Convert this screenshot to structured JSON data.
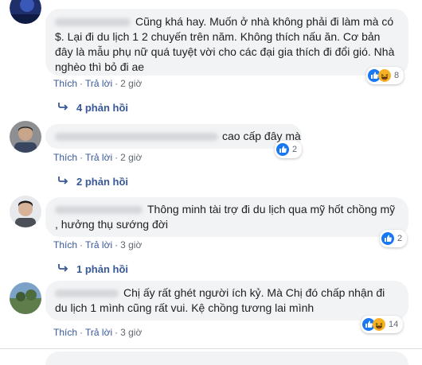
{
  "comments": [
    {
      "text_lines": [
        "Cũng khá hay. Muốn ở nhà không phải đi làm mà có",
        "$. Lại đi du lịch 1 2 chuyến trên năm. Không thích nấu ăn. Cơ bản",
        "đây là mẫu phụ nữ quá tuyệt vời cho các đại gia thích đi đổi gió. Nhà",
        "nghèo thì bỏ đi ae"
      ],
      "actions": {
        "like": "Thích",
        "reply": "Trả lời",
        "time": "2 giờ"
      },
      "reaction_count": "8",
      "replies": "4 phản hồi"
    },
    {
      "text_lines": [
        "cao cấp đây mà"
      ],
      "actions": {
        "like": "Thích",
        "reply": "Trả lời",
        "time": "2 giờ"
      },
      "reaction_count": "2",
      "replies": "2 phản hồi"
    },
    {
      "text_lines": [
        "Thông minh tài trợ đi du lịch qua mỹ hốt chồng mỹ",
        ", hưởng thụ sướng đời"
      ],
      "actions": {
        "like": "Thích",
        "reply": "Trả lời",
        "time": "3 giờ"
      },
      "reaction_count": "2",
      "replies": "1 phản hồi"
    },
    {
      "text_lines": [
        "Chị ấy rất ghét người ích kỷ. Mà Chị đó chấp nhận đi",
        "du lịch 1 mình cũng rất vui. Kệ chồng tương lai mình"
      ],
      "actions": {
        "like": "Thích",
        "reply": "Trả lời",
        "time": "3 giờ"
      },
      "reaction_count": "14"
    }
  ],
  "colors": {
    "link": "#385898",
    "bubble": "#f2f3f5",
    "like_blue": "#1877f2",
    "haha_yellow": "#f7b125"
  },
  "icons": [
    "like-icon",
    "haha-icon",
    "reply-arrow-icon"
  ]
}
